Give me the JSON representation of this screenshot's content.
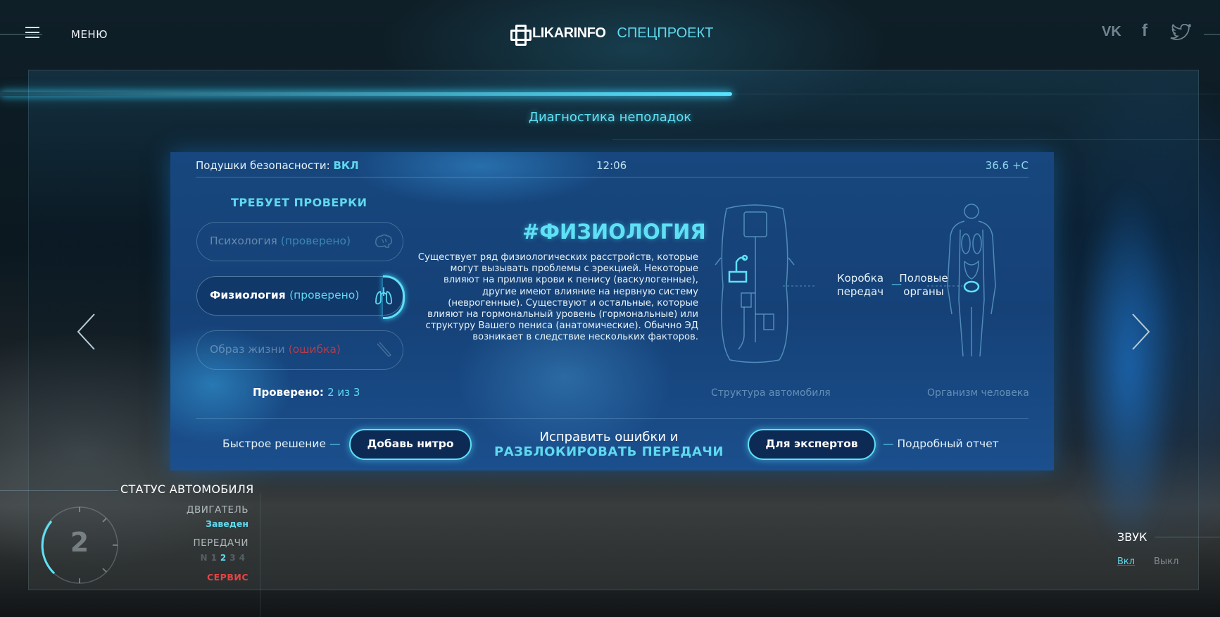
{
  "header": {
    "menu_label": "МЕНЮ",
    "logo_name": "LIKARINFO",
    "logo_special": "СПЕЦПРОЕКТ",
    "social": [
      "vk",
      "facebook",
      "twitter"
    ]
  },
  "progress": 0.6,
  "section_title": "Диагностика неполадок",
  "panel": {
    "airbag_label": "Подушки безопасности:",
    "airbag_value": "ВКЛ",
    "clock": "12:06",
    "temperature": "36.6 +C",
    "requires_check_title": "ТРЕБУЕТ ПРОВЕРКИ",
    "checks": [
      {
        "label": "Психология",
        "status": "(проверено)",
        "icon": "brain-icon"
      },
      {
        "label": "Физиология",
        "status": "(проверено)",
        "icon": "lungs-icon"
      },
      {
        "label": "Образ жизни",
        "status": "(ошибка)",
        "icon": "cigarette-icon"
      }
    ],
    "checked_label": "Проверено:",
    "checked_value": "2 из 3",
    "topic_title": "#ФИЗИОЛОГИЯ",
    "topic_text": "Существует ряд физиологических расстройств, которые могут вызывать проблемы с эрекцией. Некоторые влияют на прилив крови к пенису (васкулогенные), другие имеют влияние на нервную систему (неврогенные). Существуют и остальные, которые влияют на гормональный уровень (гормональные) или структуру Вашего пениса (анатомические). Обычно ЭД возникает в следствие нескольких факторов.",
    "mapping_left": "Коробка передач",
    "mapping_dash": "—",
    "mapping_right": "Половые органы",
    "car_label": "Структура автомобиля",
    "human_label": "Организм человека",
    "quick_label": "Быстрое решение",
    "nitro_button": "Добавь нитро",
    "fix_line1": "Исправить ошибки и",
    "fix_line2": "РАЗБЛОКИРОВАТЬ ПЕРЕДАЧИ",
    "expert_button": "Для экспертов",
    "report_label": "Подробный отчет"
  },
  "status": {
    "title": "СТАТУС АВТОМОБИЛЯ",
    "gear_number": "2",
    "engine_label": "ДВИГАТЕЛЬ",
    "engine_value": "Заведен",
    "gears_label": "ПЕРЕДАЧИ",
    "gears": [
      "N",
      "1",
      "2",
      "3",
      "4"
    ],
    "active_gear": "2",
    "service_label": "СЕРВИС"
  },
  "sound": {
    "title": "ЗВУК",
    "on": "Вкл",
    "off": "Выкл"
  },
  "colors": {
    "accent": "#5fd9ee",
    "error": "#e84343",
    "panel": "#17477e"
  }
}
